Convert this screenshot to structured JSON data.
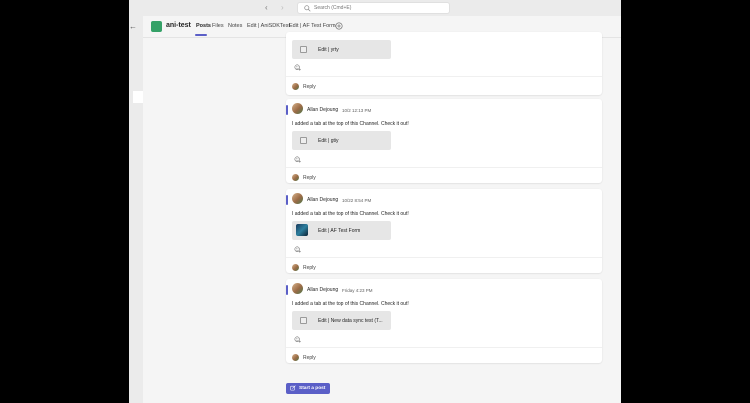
{
  "search": {
    "placeholder": "Search (Cmd+E)"
  },
  "nav": {
    "back": "‹",
    "forward": "›",
    "collapse": "←"
  },
  "channel": {
    "team_name": "ani-test",
    "tabs": [
      {
        "label": "Posts"
      },
      {
        "label": "Files"
      },
      {
        "label": "Notes"
      },
      {
        "label": "Edit | AniSDKTest"
      },
      {
        "label": "Edit | AF Test Form"
      }
    ]
  },
  "posts": [
    {
      "author": "",
      "time": "",
      "message": "",
      "tab_card": "Edit | yrty",
      "reply": "Reply"
    },
    {
      "author": "Allan Dejoung",
      "time": "10/2 12:13 PM",
      "message": "I added a tab at the top of this Channel. Check it out!",
      "tab_card": "Edit | gtiy",
      "reply": "Reply"
    },
    {
      "author": "Allan Dejoung",
      "time": "10/22 8:54 PM",
      "message": "I added a tab at the top of this Channel. Check it out!",
      "tab_card": "Edit | AF Test Form",
      "reply": "Reply"
    },
    {
      "author": "Allan Dejoung",
      "time": "Friday 4:23 PM",
      "message": "I added a tab at the top of this Channel. Check it out!",
      "tab_card": "Edit | New data sync test (T...",
      "reply": "Reply"
    }
  ],
  "composer": {
    "start_post": "Start a post"
  },
  "colors": {
    "accent": "#5b5fc7",
    "team_avatar": "#35a167"
  }
}
